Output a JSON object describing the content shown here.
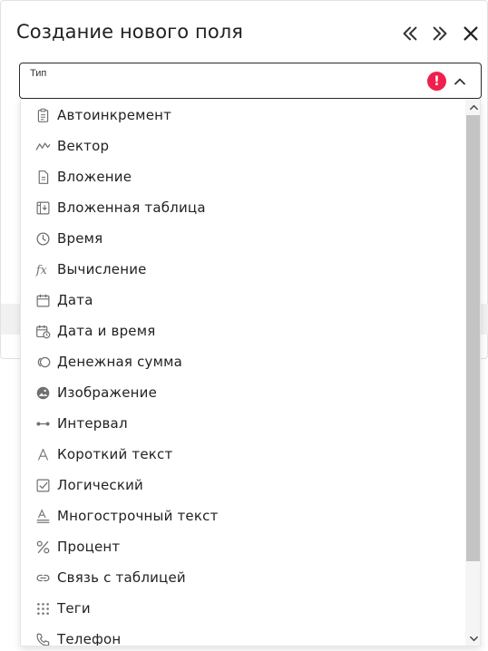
{
  "dialog": {
    "title": "Создание нового поля",
    "collapse_label": "«",
    "expand_label": "»",
    "close_label": "✕"
  },
  "type_select": {
    "label": "Тип",
    "value": "",
    "error": "!"
  },
  "options": [
    {
      "label": "Автоинкремент",
      "icon": "clipboard-icon"
    },
    {
      "label": "Вектор",
      "icon": "vector-icon"
    },
    {
      "label": "Вложение",
      "icon": "document-icon"
    },
    {
      "label": "Вложенная таблица",
      "icon": "nested-table-icon"
    },
    {
      "label": "Время",
      "icon": "clock-icon"
    },
    {
      "label": "Вычисление",
      "icon": "function-icon"
    },
    {
      "label": "Дата",
      "icon": "calendar-icon"
    },
    {
      "label": "Дата и время",
      "icon": "calendar-clock-icon"
    },
    {
      "label": "Денежная сумма",
      "icon": "coins-icon"
    },
    {
      "label": "Изображение",
      "icon": "image-icon"
    },
    {
      "label": "Интервал",
      "icon": "interval-icon"
    },
    {
      "label": "Короткий текст",
      "icon": "text-a-icon"
    },
    {
      "label": "Логический",
      "icon": "checkbox-icon"
    },
    {
      "label": "Многострочный текст",
      "icon": "multiline-text-icon"
    },
    {
      "label": "Процент",
      "icon": "percent-icon"
    },
    {
      "label": "Связь с таблицей",
      "icon": "link-icon"
    },
    {
      "label": "Теги",
      "icon": "dots-grid-icon"
    },
    {
      "label": "Телефон",
      "icon": "phone-icon"
    }
  ],
  "colors": {
    "error": "#f0204e",
    "icon": "#707070",
    "scroll_thumb": "#c4c4c4"
  }
}
